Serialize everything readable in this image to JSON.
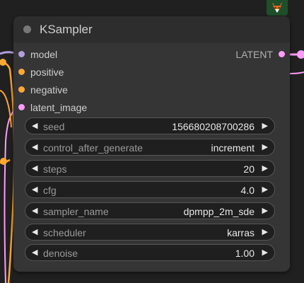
{
  "colors": {
    "model": "#b39ddb",
    "clip_or_conditioning": "#ffa931",
    "latent": "#ff9cf9",
    "background": "#202020",
    "node_body": "#353535"
  },
  "badge": {
    "icon": "fox-icon"
  },
  "node": {
    "title": "KSampler",
    "inputs": [
      {
        "label": "model",
        "color": "#b39ddb"
      },
      {
        "label": "positive",
        "color": "#ffa931"
      },
      {
        "label": "negative",
        "color": "#ffa931"
      },
      {
        "label": "latent_image",
        "color": "#ff9cf9"
      }
    ],
    "output": {
      "label": "LATENT",
      "color": "#ff9cf9"
    },
    "widgets": [
      {
        "name": "seed",
        "value": "156680208700286"
      },
      {
        "name": "control_after_generate",
        "value": "increment"
      },
      {
        "name": "steps",
        "value": "20"
      },
      {
        "name": "cfg",
        "value": "4.0"
      },
      {
        "name": "sampler_name",
        "value": "dpmpp_2m_sde"
      },
      {
        "name": "scheduler",
        "value": "karras"
      },
      {
        "name": "denoise",
        "value": "1.00"
      }
    ],
    "arrow_left": "◀",
    "arrow_right": "▶"
  }
}
